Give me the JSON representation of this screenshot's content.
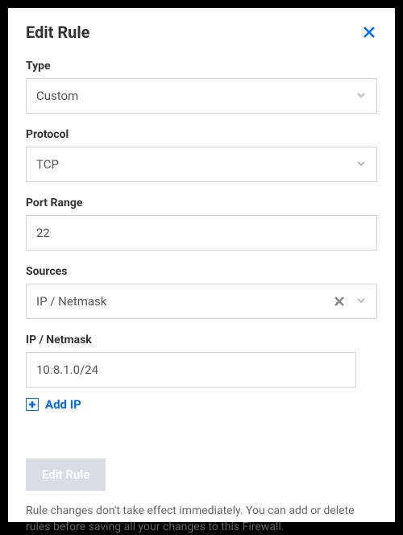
{
  "modal": {
    "title": "Edit Rule"
  },
  "fields": {
    "type": {
      "label": "Type",
      "value": "Custom"
    },
    "protocol": {
      "label": "Protocol",
      "value": "TCP"
    },
    "portRange": {
      "label": "Port Range",
      "value": "22"
    },
    "sources": {
      "label": "Sources",
      "value": "IP / Netmask"
    },
    "ipNetmask": {
      "label": "IP / Netmask",
      "value": "10.8.1.0/24"
    }
  },
  "actions": {
    "addIp": "Add IP",
    "submit": "Edit Rule"
  },
  "footer": {
    "text": "Rule changes don't take effect immediately. You can add or delete rules before saving all your changes to this Firewall."
  }
}
